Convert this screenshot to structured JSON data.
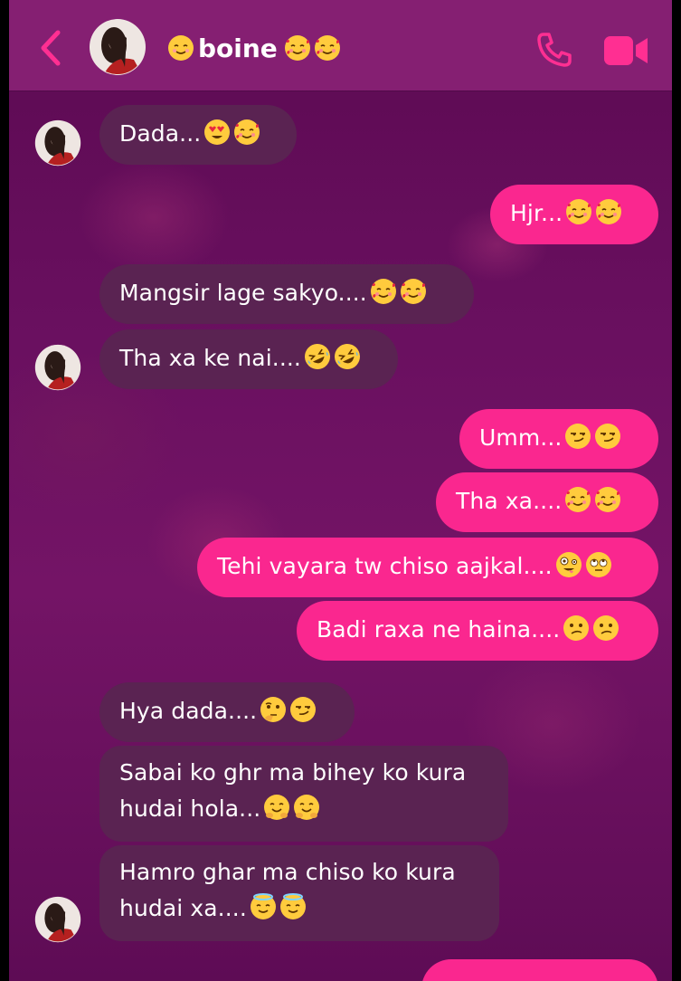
{
  "header": {
    "title": "☺️boine🥰🥰",
    "title_text": "boine"
  },
  "colors": {
    "header_bg": "#851f72",
    "accent": "#ff2f92",
    "incoming_bubble": "#5a2352",
    "outgoing_bubble": "#fa278f",
    "background": "#6a1060"
  },
  "icons": [
    "back-icon",
    "phone-icon",
    "video-camera-icon"
  ],
  "messages": [
    {
      "side": "in",
      "text": "Dada...",
      "emoji": [
        "😍",
        "🥰"
      ]
    },
    {
      "side": "out",
      "text": "Hjr...",
      "emoji": [
        "🥰",
        "🥰"
      ]
    },
    {
      "side": "in",
      "text": "Mangsir lage sakyo....",
      "emoji": [
        "🥰",
        "🥰"
      ]
    },
    {
      "side": "in",
      "text": "Tha xa ke nai....",
      "emoji": [
        "🤣",
        "🤣"
      ]
    },
    {
      "side": "out",
      "text": "Umm...",
      "emoji": [
        "😏",
        "😏"
      ]
    },
    {
      "side": "out",
      "text": "Tha xa....",
      "emoji": [
        "🥰",
        "🥰"
      ]
    },
    {
      "side": "out",
      "text": "Tehi vayara tw chiso aajkal....",
      "emoji": [
        "🤪",
        "🙄"
      ]
    },
    {
      "side": "out",
      "text": "Badi raxa ne haina....",
      "emoji": [
        "😕",
        "😕"
      ]
    },
    {
      "side": "in",
      "text": "Hya dada....",
      "emoji": [
        "🤔",
        "😏"
      ]
    },
    {
      "side": "in",
      "text": "Sabai ko ghr ma bihey ko kura hudai hola...",
      "emoji": [
        "🤗",
        "🤗"
      ]
    },
    {
      "side": "in",
      "text": "Hamro ghar ma chiso ko kura hudai xa....",
      "emoji": [
        "😇",
        "😇"
      ]
    },
    {
      "side": "out",
      "text": "",
      "emoji": []
    }
  ]
}
